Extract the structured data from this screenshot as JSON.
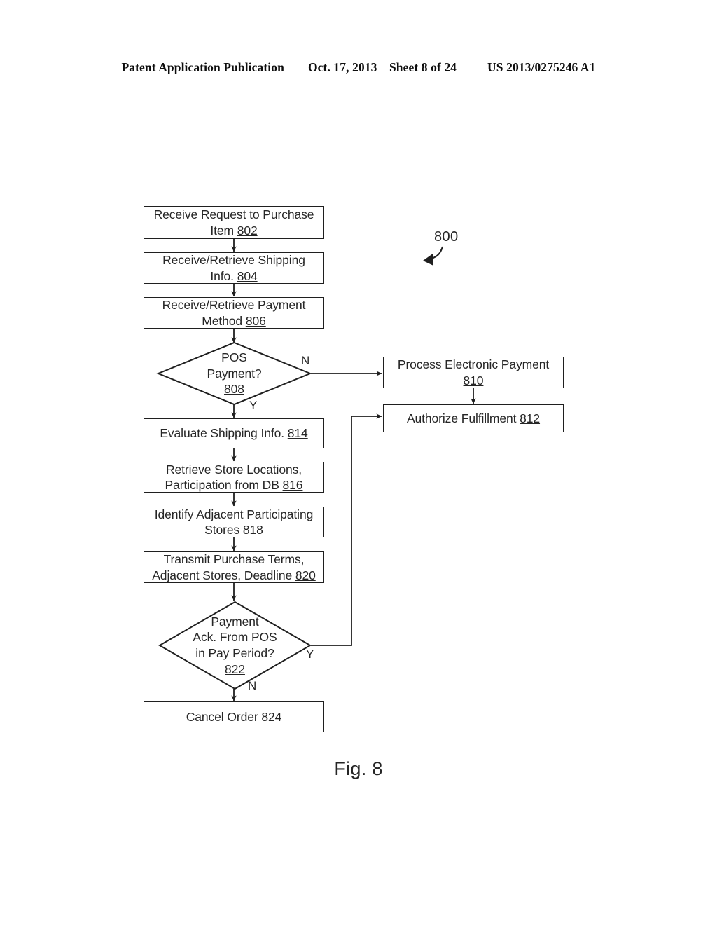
{
  "header": {
    "publication": "Patent Application Publication",
    "date": "Oct. 17, 2013",
    "sheet": "Sheet 8 of 24",
    "pub_number": "US 2013/0275246 A1"
  },
  "figure": {
    "caption": "Fig. 8",
    "reference_label": "800"
  },
  "flowchart": {
    "nodes": [
      {
        "id": "802",
        "shape": "process",
        "line1": "Receive Request to Purchase",
        "line2": "Item ",
        "ref": "802"
      },
      {
        "id": "804",
        "shape": "process",
        "line1": "Receive/Retrieve Shipping",
        "line2": "Info. ",
        "ref": "804"
      },
      {
        "id": "806",
        "shape": "process",
        "line1": "Receive/Retrieve Payment",
        "line2": "Method ",
        "ref": "806"
      },
      {
        "id": "808",
        "shape": "decision",
        "line1": "POS",
        "line2": "Payment?",
        "ref": "808"
      },
      {
        "id": "810",
        "shape": "process",
        "line1": "Process Electronic Payment",
        "line2": "",
        "ref": "810"
      },
      {
        "id": "812",
        "shape": "process",
        "line1": "Authorize Fulfillment ",
        "line2": "",
        "ref": "812"
      },
      {
        "id": "814",
        "shape": "process",
        "line1": "Evaluate Shipping Info. ",
        "line2": "",
        "ref": "814"
      },
      {
        "id": "816",
        "shape": "process",
        "line1": "Retrieve Store Locations,",
        "line2": "Participation from DB ",
        "ref": "816"
      },
      {
        "id": "818",
        "shape": "process",
        "line1": "Identify Adjacent Participating",
        "line2": "Stores ",
        "ref": "818"
      },
      {
        "id": "820",
        "shape": "process",
        "line1": "Transmit Purchase Terms,",
        "line2": "Adjacent Stores, Deadline ",
        "ref": "820"
      },
      {
        "id": "822",
        "shape": "decision",
        "line1": "Payment",
        "line2": "Ack. From POS",
        "line3": "in Pay Period?",
        "ref": "822"
      },
      {
        "id": "824",
        "shape": "process",
        "line1": "Cancel Order ",
        "line2": "",
        "ref": "824"
      }
    ],
    "branch_labels": {
      "d808_no": "N",
      "d808_yes": "Y",
      "d822_yes": "Y",
      "d822_no": "N"
    }
  },
  "colors": {
    "ink": "#262626",
    "stroke": "#1f1f1f",
    "paper": "#ffffff"
  }
}
